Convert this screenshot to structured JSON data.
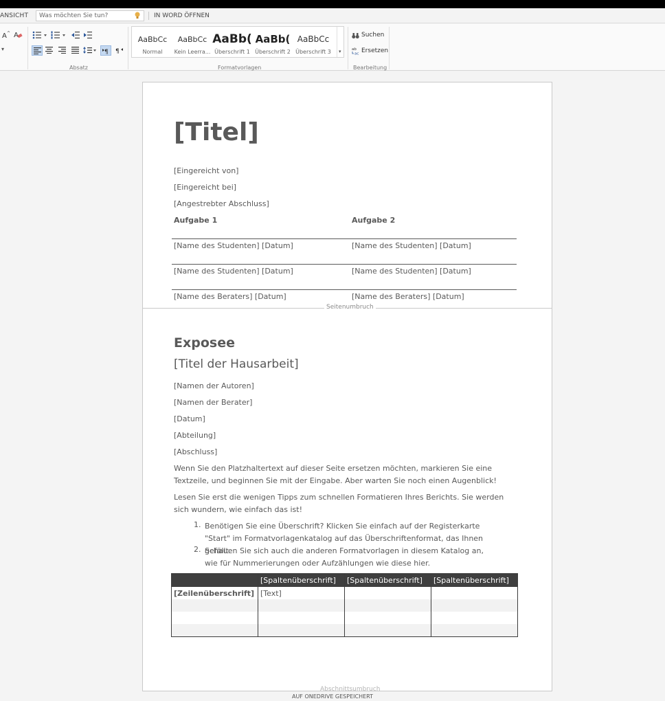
{
  "menubar": {
    "view_tab": "ANSICHT",
    "tell_me_placeholder": "Was möchten Sie tun?",
    "open_in_word": "IN WORD ÖFFNEN"
  },
  "ribbon": {
    "paragraph_group": "Absatz",
    "styles_group": "Formatvorlagen",
    "editing_group": "Bearbeitung",
    "styles": [
      {
        "sample": "AaBbCc",
        "name": "Normal"
      },
      {
        "sample": "AaBbCc",
        "name": "Kein Leerra..."
      },
      {
        "sample": "AaBb(",
        "name": "Überschrift 1"
      },
      {
        "sample": "AaBb(",
        "name": "Überschrift 2"
      },
      {
        "sample": "AaBbCc",
        "name": "Überschrift 3"
      }
    ],
    "find_label": "Suchen",
    "replace_label": "Ersetzen"
  },
  "document": {
    "title": "[Titel]",
    "submitted_by": "[Eingereicht von]",
    "submitted_to": "[Eingereicht bei]",
    "degree": "[Angestrebter Abschluss]",
    "task1": "Aufgabe 1",
    "task2": "Aufgabe 2",
    "signature_rows": [
      {
        "left": "[Name des Studenten] [Datum]",
        "right": "[Name des Studenten] [Datum]"
      },
      {
        "left": "[Name des Studenten] [Datum]",
        "right": "[Name des Studenten] [Datum]"
      },
      {
        "left": "[Name des Beraters] [Datum]",
        "right": "[Name des Beraters] [Datum]"
      }
    ],
    "page_break": "Seitenumbruch",
    "expose_heading": "Exposee",
    "thesis_title": "[Titel der Hausarbeit]",
    "authors": "[Namen der Autoren]",
    "advisors": "[Namen der Berater]",
    "date": "[Datum]",
    "department": "[Abteilung]",
    "degree_short": "[Abschluss]",
    "para1": "Wenn Sie den Platzhaltertext auf dieser Seite ersetzen möchten, markieren Sie eine Textzeile, und beginnen Sie mit der Eingabe. Aber warten Sie noch einen Augenblick!",
    "para2": "Lesen Sie erst die wenigen Tipps zum schnellen Formatieren Ihres Berichts. Sie werden sich wundern, wie einfach das ist!",
    "list": [
      {
        "num": "1.",
        "text": "Benötigen Sie eine Überschrift? Klicken Sie einfach auf der Registerkarte \"Start\" im Formatvorlagenkatalog auf das Überschriftenformat, das Ihnen gefällt."
      },
      {
        "num": "2.",
        "text": "Schauen Sie sich auch die anderen Formatvorlagen in diesem Katalog an, wie für Nummerierungen oder Aufzählungen wie diese hier."
      }
    ],
    "table": {
      "headers": [
        "",
        "[Spaltenüberschrift]",
        "[Spaltenüberschrift]",
        "[Spaltenüberschrift]"
      ],
      "row_header": "[Zeilenüberschrift]",
      "cell_text": "[Text]"
    },
    "section_break": "Abschnittsumbruch"
  },
  "statusbar": {
    "save_state": "AUF ONEDRIVE GESPEICHERT"
  }
}
